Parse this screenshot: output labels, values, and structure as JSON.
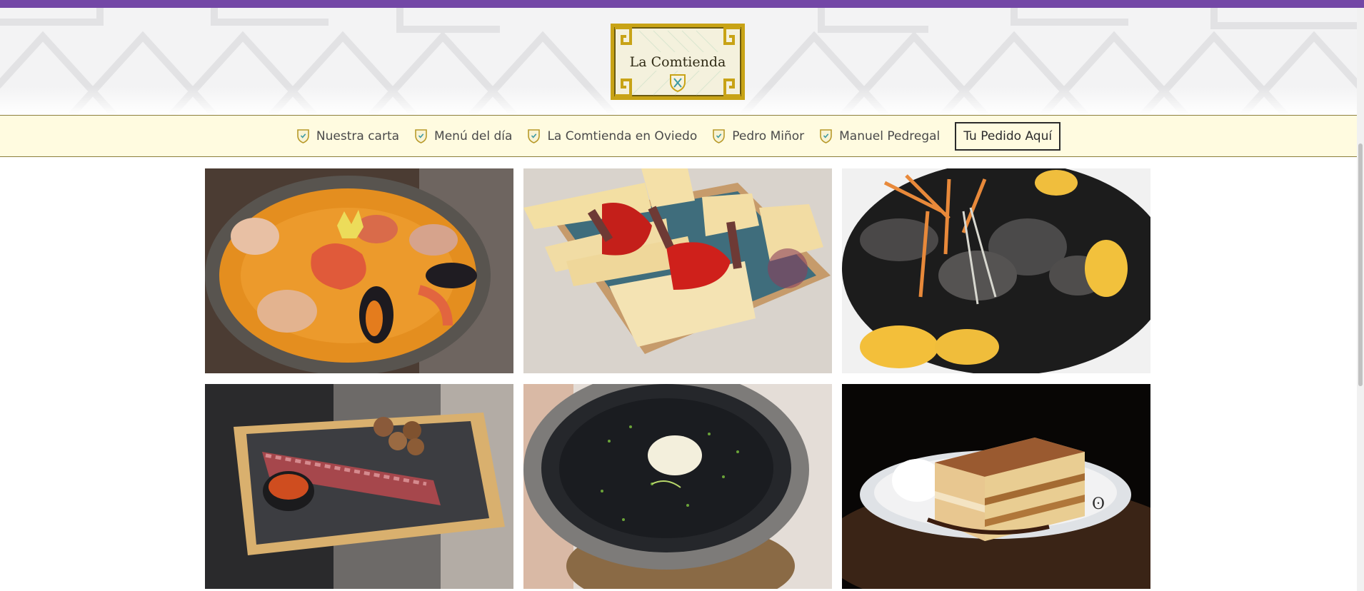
{
  "brand": {
    "name": "La Comtienda",
    "accent_color": "#7347a6",
    "nav_background": "#fffbe0",
    "logo_gold": "#c8a316"
  },
  "nav": {
    "items": [
      {
        "label": "Nuestra carta",
        "icon": "shield-icon"
      },
      {
        "label": "Menú del día",
        "icon": "shield-icon"
      },
      {
        "label": "La Comtienda en Oviedo",
        "icon": "shield-icon"
      },
      {
        "label": "Pedro Miñor",
        "icon": "shield-icon"
      },
      {
        "label": "Manuel Pedregal",
        "icon": "shield-icon"
      }
    ],
    "cta_label": "Tu Pedido Aquí"
  },
  "gallery": {
    "photos": [
      {
        "subject": "seafood paella"
      },
      {
        "subject": "cheese and anchovy plate"
      },
      {
        "subject": "squid in black ink"
      },
      {
        "subject": "sliced steak with potatoes"
      },
      {
        "subject": "black rice paella"
      },
      {
        "subject": "tiramisu cake"
      }
    ]
  }
}
